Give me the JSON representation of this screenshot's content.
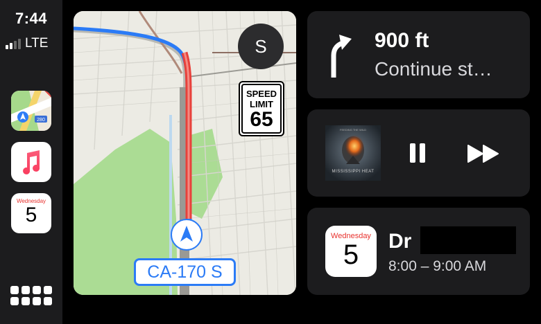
{
  "status": {
    "time": "7:44",
    "network": "LTE",
    "signal_bars": 2
  },
  "dock": {
    "apps": [
      {
        "name": "Maps",
        "icon": "maps-icon",
        "badge": "280"
      },
      {
        "name": "Music",
        "icon": "music-note-icon"
      },
      {
        "name": "Calendar",
        "icon": "calendar-icon",
        "weekday": "Wednesday",
        "day": "5"
      }
    ],
    "grid_icon": "app-grid-icon"
  },
  "map": {
    "user_initial": "S",
    "speed_limit_label": "SPEED LIMIT",
    "speed_limit_value": "65",
    "road_name": "CA-170 S"
  },
  "navigation": {
    "distance": "900 ft",
    "instruction": "Continue st…",
    "maneuver_icon": "turn-arrow-icon"
  },
  "now_playing": {
    "album_cover_text": "MISSISSIPPI HEAT",
    "album_cover_top": "FEEDING THE WILD",
    "controls": [
      "pause-icon",
      "fast-forward-icon"
    ]
  },
  "calendar_event": {
    "weekday": "Wednesday",
    "day": "5",
    "title": "Dr",
    "time": "8:00 – 9:00 AM"
  },
  "colors": {
    "route_blue": "#2b7bf6",
    "route_red": "#e8413b",
    "park_green": "#a9dd91",
    "card_bg": "#1c1c1e",
    "accent_red": "#e8322e"
  }
}
